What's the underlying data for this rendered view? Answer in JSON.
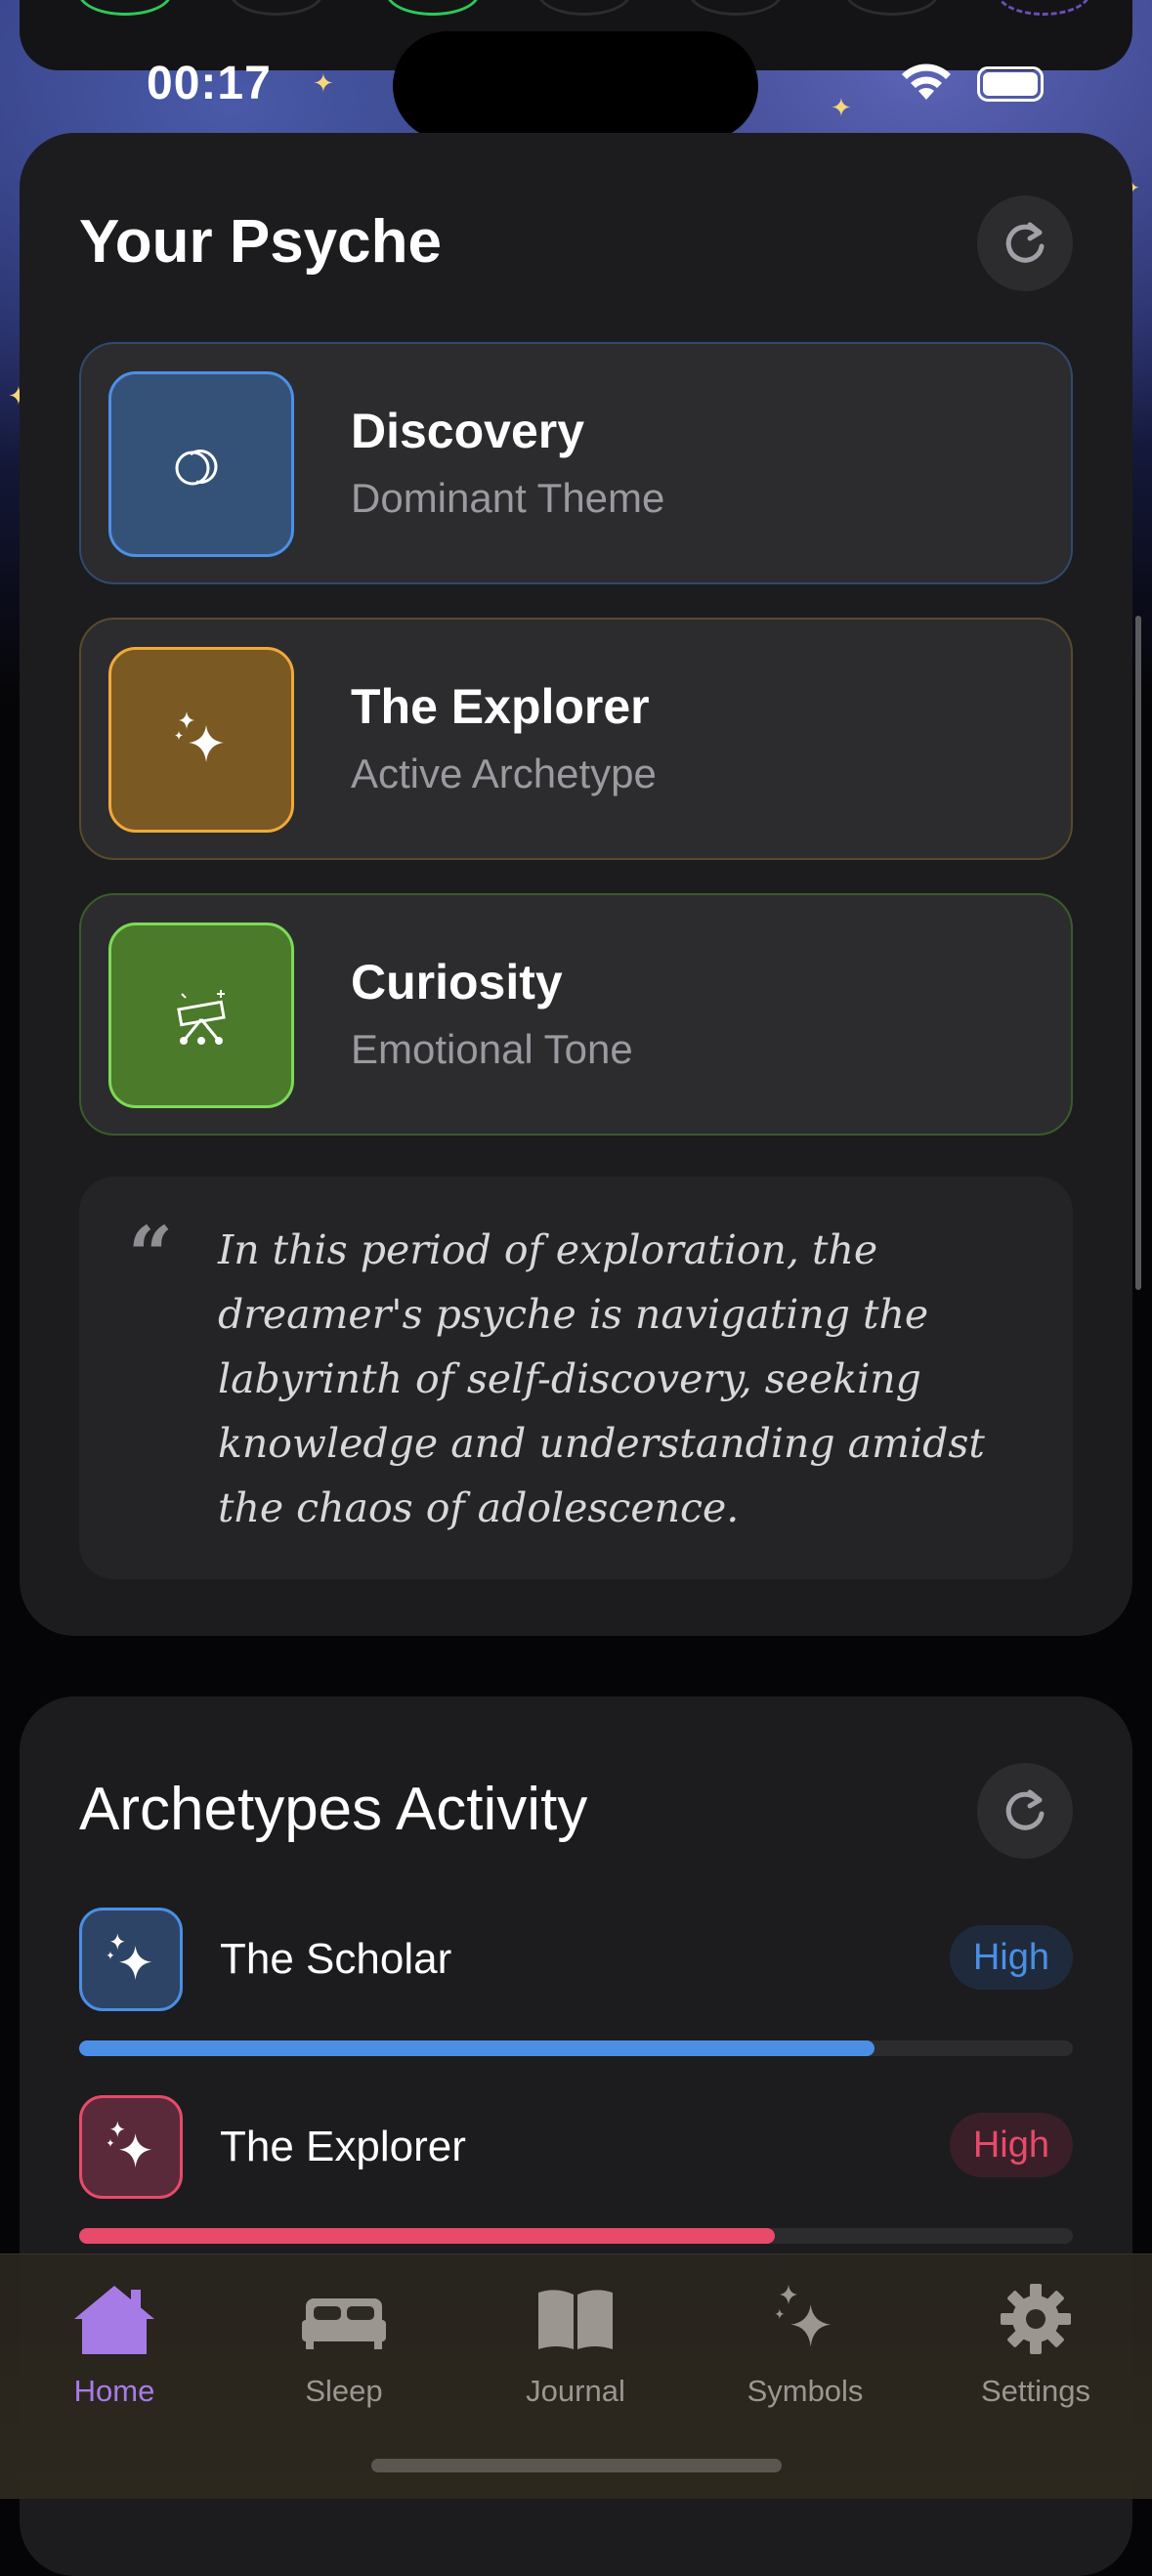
{
  "status_bar": {
    "time": "00:17"
  },
  "psyche": {
    "title": "Your Psyche",
    "items": [
      {
        "label": "Discovery",
        "sub": "Dominant Theme",
        "icon": "circles-icon",
        "color": "#4d8fe8"
      },
      {
        "label": "The Explorer",
        "sub": "Active Archetype",
        "icon": "sparkles-icon",
        "color": "#f0a93a"
      },
      {
        "label": "Curiosity",
        "sub": "Emotional Tone",
        "icon": "telescope-icon",
        "color": "#7ed957"
      }
    ],
    "quote": "In this period of exploration, the dreamer's psyche is navigating the labyrinth of self-discovery, seeking knowledge and understanding amidst the chaos of adolescence."
  },
  "archetypes": {
    "title": "Archetypes Activity",
    "items": [
      {
        "name": "The Scholar",
        "level": "High",
        "fill": 0.8,
        "color": "#4a8fe5"
      },
      {
        "name": "The Explorer",
        "level": "High",
        "fill": 0.7,
        "color": "#e84a6a"
      }
    ]
  },
  "tabbar": {
    "tabs": [
      {
        "label": "Home",
        "active": true
      },
      {
        "label": "Sleep",
        "active": false
      },
      {
        "label": "Journal",
        "active": false
      },
      {
        "label": "Symbols",
        "active": false
      },
      {
        "label": "Settings",
        "active": false
      }
    ]
  }
}
